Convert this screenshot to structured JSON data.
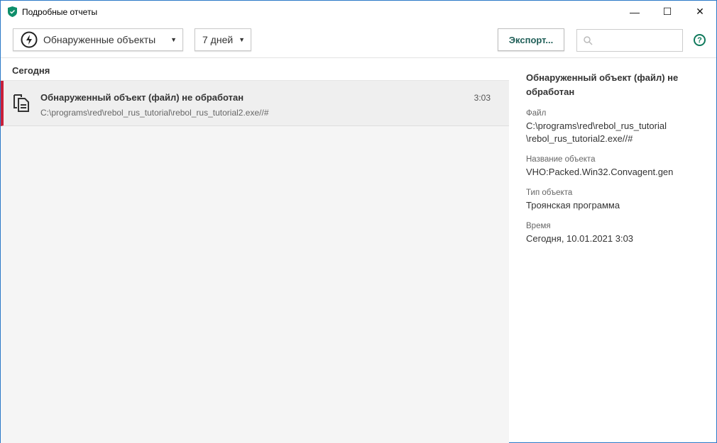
{
  "window": {
    "title": "Подробные отчеты",
    "minimize": "—",
    "maximize": "☐",
    "close": "✕"
  },
  "toolbar": {
    "category": "Обнаруженные объекты",
    "period": "7 дней",
    "export": "Экспорт...",
    "search_placeholder": "",
    "help": "?"
  },
  "list": {
    "section": "Сегодня",
    "items": [
      {
        "title": "Обнаруженный объект (файл) не обработан",
        "path": "C:\\programs\\red\\rebol_rus_tutorial\\rebol_rus_tutorial2.exe//#",
        "time": "3:03"
      }
    ]
  },
  "details": {
    "title": "Обнаруженный объект (файл) не обработан",
    "fields": [
      {
        "label": "Файл",
        "value": "C:\\programs\\red\\rebol_rus_tutorial \\rebol_rus_tutorial2.exe//#"
      },
      {
        "label": "Название объекта",
        "value": "VHO:Packed.Win32.Convagent.gen"
      },
      {
        "label": "Тип объекта",
        "value": "Троянская программа"
      },
      {
        "label": "Время",
        "value": "Сегодня, 10.01.2021 3:03"
      }
    ]
  },
  "colors": {
    "accent": "#107a5c",
    "alert": "#c8203a"
  }
}
